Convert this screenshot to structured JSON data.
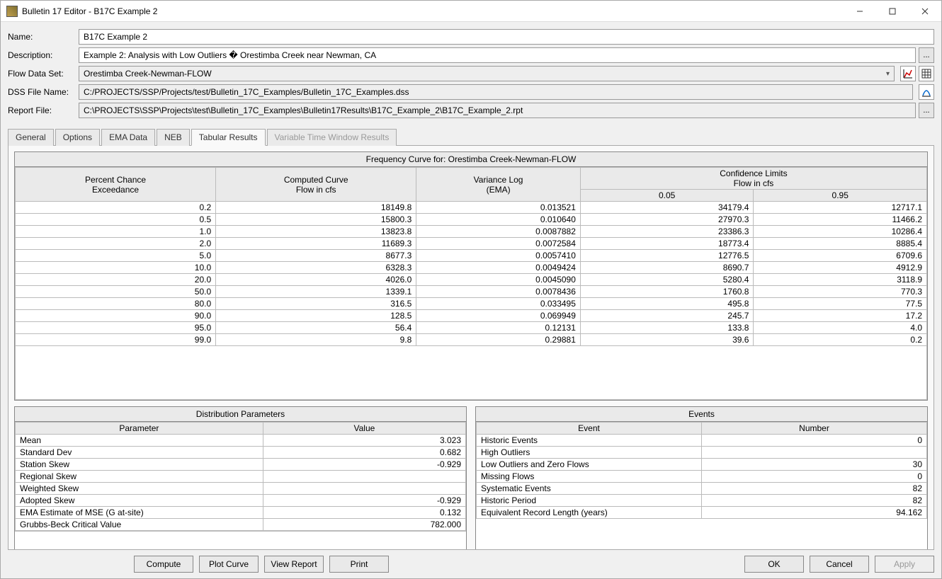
{
  "window": {
    "title": "Bulletin 17 Editor - B17C Example 2"
  },
  "form": {
    "labels": {
      "name": "Name:",
      "description": "Description:",
      "flowdata": "Flow Data Set:",
      "dssfile": "DSS File Name:",
      "report": "Report File:"
    },
    "name": "B17C Example 2",
    "description": "Example 2: Analysis with Low Outliers � Orestimba Creek near Newman, CA",
    "flowdata": "Orestimba Creek-Newman-FLOW",
    "dssfile": "C:/PROJECTS/SSP/Projects/test/Bulletin_17C_Examples/Bulletin_17C_Examples.dss",
    "report": "C:\\PROJECTS\\SSP\\Projects\\test\\Bulletin_17C_Examples\\Bulletin17Results\\B17C_Example_2\\B17C_Example_2.rpt",
    "browse": "..."
  },
  "tabs": {
    "general": "General",
    "options": "Options",
    "ema": "EMA Data",
    "neb": "NEB",
    "tabular": "Tabular Results",
    "vtw": "Variable Time Window Results"
  },
  "freq": {
    "title": "Frequency Curve for: Orestimba Creek-Newman-FLOW",
    "headers": {
      "pce": "Percent Chance\nExceedance",
      "curve": "Computed Curve\nFlow in cfs",
      "var": "Variance Log\n(EMA)",
      "conf": "Confidence Limits\nFlow in cfs",
      "cl05": "0.05",
      "cl95": "0.95"
    },
    "rows": [
      {
        "p": "0.2",
        "c": "18149.8",
        "v": "0.013521",
        "a": "34179.4",
        "b": "12717.1"
      },
      {
        "p": "0.5",
        "c": "15800.3",
        "v": "0.010640",
        "a": "27970.3",
        "b": "11466.2"
      },
      {
        "p": "1.0",
        "c": "13823.8",
        "v": "0.0087882",
        "a": "23386.3",
        "b": "10286.4"
      },
      {
        "p": "2.0",
        "c": "11689.3",
        "v": "0.0072584",
        "a": "18773.4",
        "b": "8885.4"
      },
      {
        "p": "5.0",
        "c": "8677.3",
        "v": "0.0057410",
        "a": "12776.5",
        "b": "6709.6"
      },
      {
        "p": "10.0",
        "c": "6328.3",
        "v": "0.0049424",
        "a": "8690.7",
        "b": "4912.9"
      },
      {
        "p": "20.0",
        "c": "4026.0",
        "v": "0.0045090",
        "a": "5280.4",
        "b": "3118.9"
      },
      {
        "p": "50.0",
        "c": "1339.1",
        "v": "0.0078436",
        "a": "1760.8",
        "b": "770.3"
      },
      {
        "p": "80.0",
        "c": "316.5",
        "v": "0.033495",
        "a": "495.8",
        "b": "77.5"
      },
      {
        "p": "90.0",
        "c": "128.5",
        "v": "0.069949",
        "a": "245.7",
        "b": "17.2"
      },
      {
        "p": "95.0",
        "c": "56.4",
        "v": "0.12131",
        "a": "133.8",
        "b": "4.0"
      },
      {
        "p": "99.0",
        "c": "9.8",
        "v": "0.29881",
        "a": "39.6",
        "b": "0.2"
      }
    ]
  },
  "distparams": {
    "title": "Distribution Parameters",
    "headers": {
      "param": "Parameter",
      "value": "Value"
    },
    "rows": [
      {
        "p": "Mean",
        "v": "3.023"
      },
      {
        "p": "Standard Dev",
        "v": "0.682"
      },
      {
        "p": "Station Skew",
        "v": "-0.929"
      },
      {
        "p": "Regional Skew",
        "v": ""
      },
      {
        "p": "Weighted Skew",
        "v": ""
      },
      {
        "p": "Adopted Skew",
        "v": "-0.929"
      },
      {
        "p": "EMA Estimate of MSE (G at-site)",
        "v": "0.132"
      },
      {
        "p": "Grubbs-Beck Critical Value",
        "v": "782.000"
      }
    ]
  },
  "events": {
    "title": "Events",
    "headers": {
      "event": "Event",
      "number": "Number"
    },
    "rows": [
      {
        "e": "Historic Events",
        "n": "0"
      },
      {
        "e": "High Outliers",
        "n": ""
      },
      {
        "e": "Low Outliers and Zero Flows",
        "n": "30"
      },
      {
        "e": "Missing Flows",
        "n": "0"
      },
      {
        "e": "Systematic Events",
        "n": "82"
      },
      {
        "e": "Historic Period",
        "n": "82"
      },
      {
        "e": "Equivalent Record Length (years)",
        "n": "94.162"
      }
    ]
  },
  "buttons": {
    "compute": "Compute",
    "plot": "Plot Curve",
    "view": "View Report",
    "print": "Print",
    "ok": "OK",
    "cancel": "Cancel",
    "apply": "Apply"
  }
}
